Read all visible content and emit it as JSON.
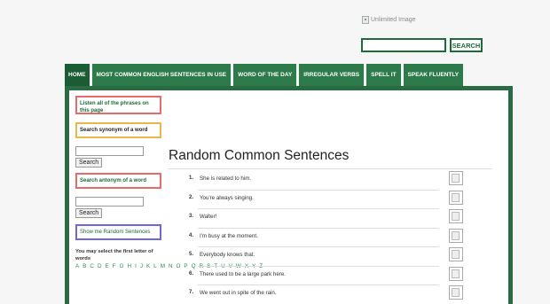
{
  "header": {
    "image_alt": "Unlimited Image",
    "search_placeholder": "",
    "search_button": "SEARCH"
  },
  "nav": {
    "tabs": [
      {
        "label": "HOME"
      },
      {
        "label": "MOST COMMON ENGLISH SENTENCES IN USE"
      },
      {
        "label": "WORD OF THE DAY"
      },
      {
        "label": "IRREGULAR VERBS"
      },
      {
        "label": "SPELL IT"
      },
      {
        "label": "SPEAK FLUENTLY"
      }
    ]
  },
  "sidebar": {
    "listen_link": "Listen all of the phrases on this page",
    "synonym_label": "Search synonym of a word",
    "synonym_button": "Search",
    "antonym_label": "Search antonym of a word",
    "antonym_button": "Search",
    "random_link": "Show me Random Sentences",
    "letters_label": "You may select the first letter of words",
    "letters": [
      "A",
      "B",
      "C",
      "D",
      "E",
      "F",
      "G",
      "H",
      "I",
      "J",
      "K",
      "L",
      "M",
      "N",
      "O",
      "P",
      "Q",
      "R",
      "S",
      "T",
      "U",
      "V",
      "W",
      "X",
      "Y",
      "Z"
    ]
  },
  "main": {
    "title": "Random Common Sentences",
    "sentences": [
      {
        "num": "1.",
        "text": "She is related to him."
      },
      {
        "num": "2.",
        "text": "You're always singing."
      },
      {
        "num": "3.",
        "text": "Walter!"
      },
      {
        "num": "4.",
        "text": "I'm busy at the moment."
      },
      {
        "num": "5.",
        "text": "Everybody knows that."
      },
      {
        "num": "6.",
        "text": "There used to be a large park here."
      },
      {
        "num": "7.",
        "text": "We went out in spite of the rain."
      }
    ]
  }
}
